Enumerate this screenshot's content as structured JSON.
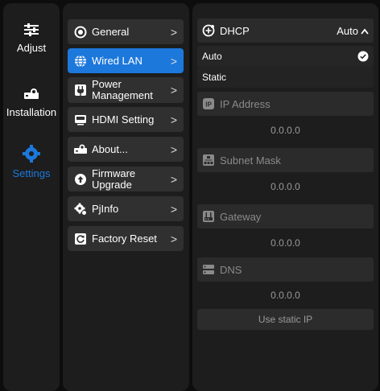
{
  "nav": [
    {
      "label": "Adjust",
      "icon": "sliders-icon"
    },
    {
      "label": "Installation",
      "icon": "projector-icon"
    },
    {
      "label": "Settings",
      "icon": "gear-icon",
      "active": true
    }
  ],
  "menu": [
    {
      "label": "General",
      "icon": "circle-dot-icon"
    },
    {
      "label": "Wired LAN",
      "icon": "globe-icon",
      "active": true
    },
    {
      "label": "Power Management",
      "icon": "plug-icon"
    },
    {
      "label": "HDMI Setting",
      "icon": "monitor-icon"
    },
    {
      "label": "About...",
      "icon": "projector-icon"
    },
    {
      "label": "Firmware Upgrade",
      "icon": "upload-icon"
    },
    {
      "label": "PjInfo",
      "icon": "gear-info-icon"
    },
    {
      "label": "Factory Reset",
      "icon": "reset-icon"
    }
  ],
  "chevron": ">",
  "dhcp": {
    "label": "DHCP",
    "value": "Auto",
    "options": [
      "Auto",
      "Static"
    ]
  },
  "ip": {
    "label": "IP Address",
    "value": "0.0.0.0"
  },
  "subnet": {
    "label": "Subnet Mask",
    "value": "0.0.0.0"
  },
  "gateway": {
    "label": "Gateway",
    "value": "0.0.0.0"
  },
  "dns": {
    "label": "DNS",
    "value": "0.0.0.0"
  },
  "static_btn": "Use static IP",
  "colors": {
    "accent": "#1d78dc",
    "panel": "#1d1d1d",
    "item": "#303030"
  }
}
